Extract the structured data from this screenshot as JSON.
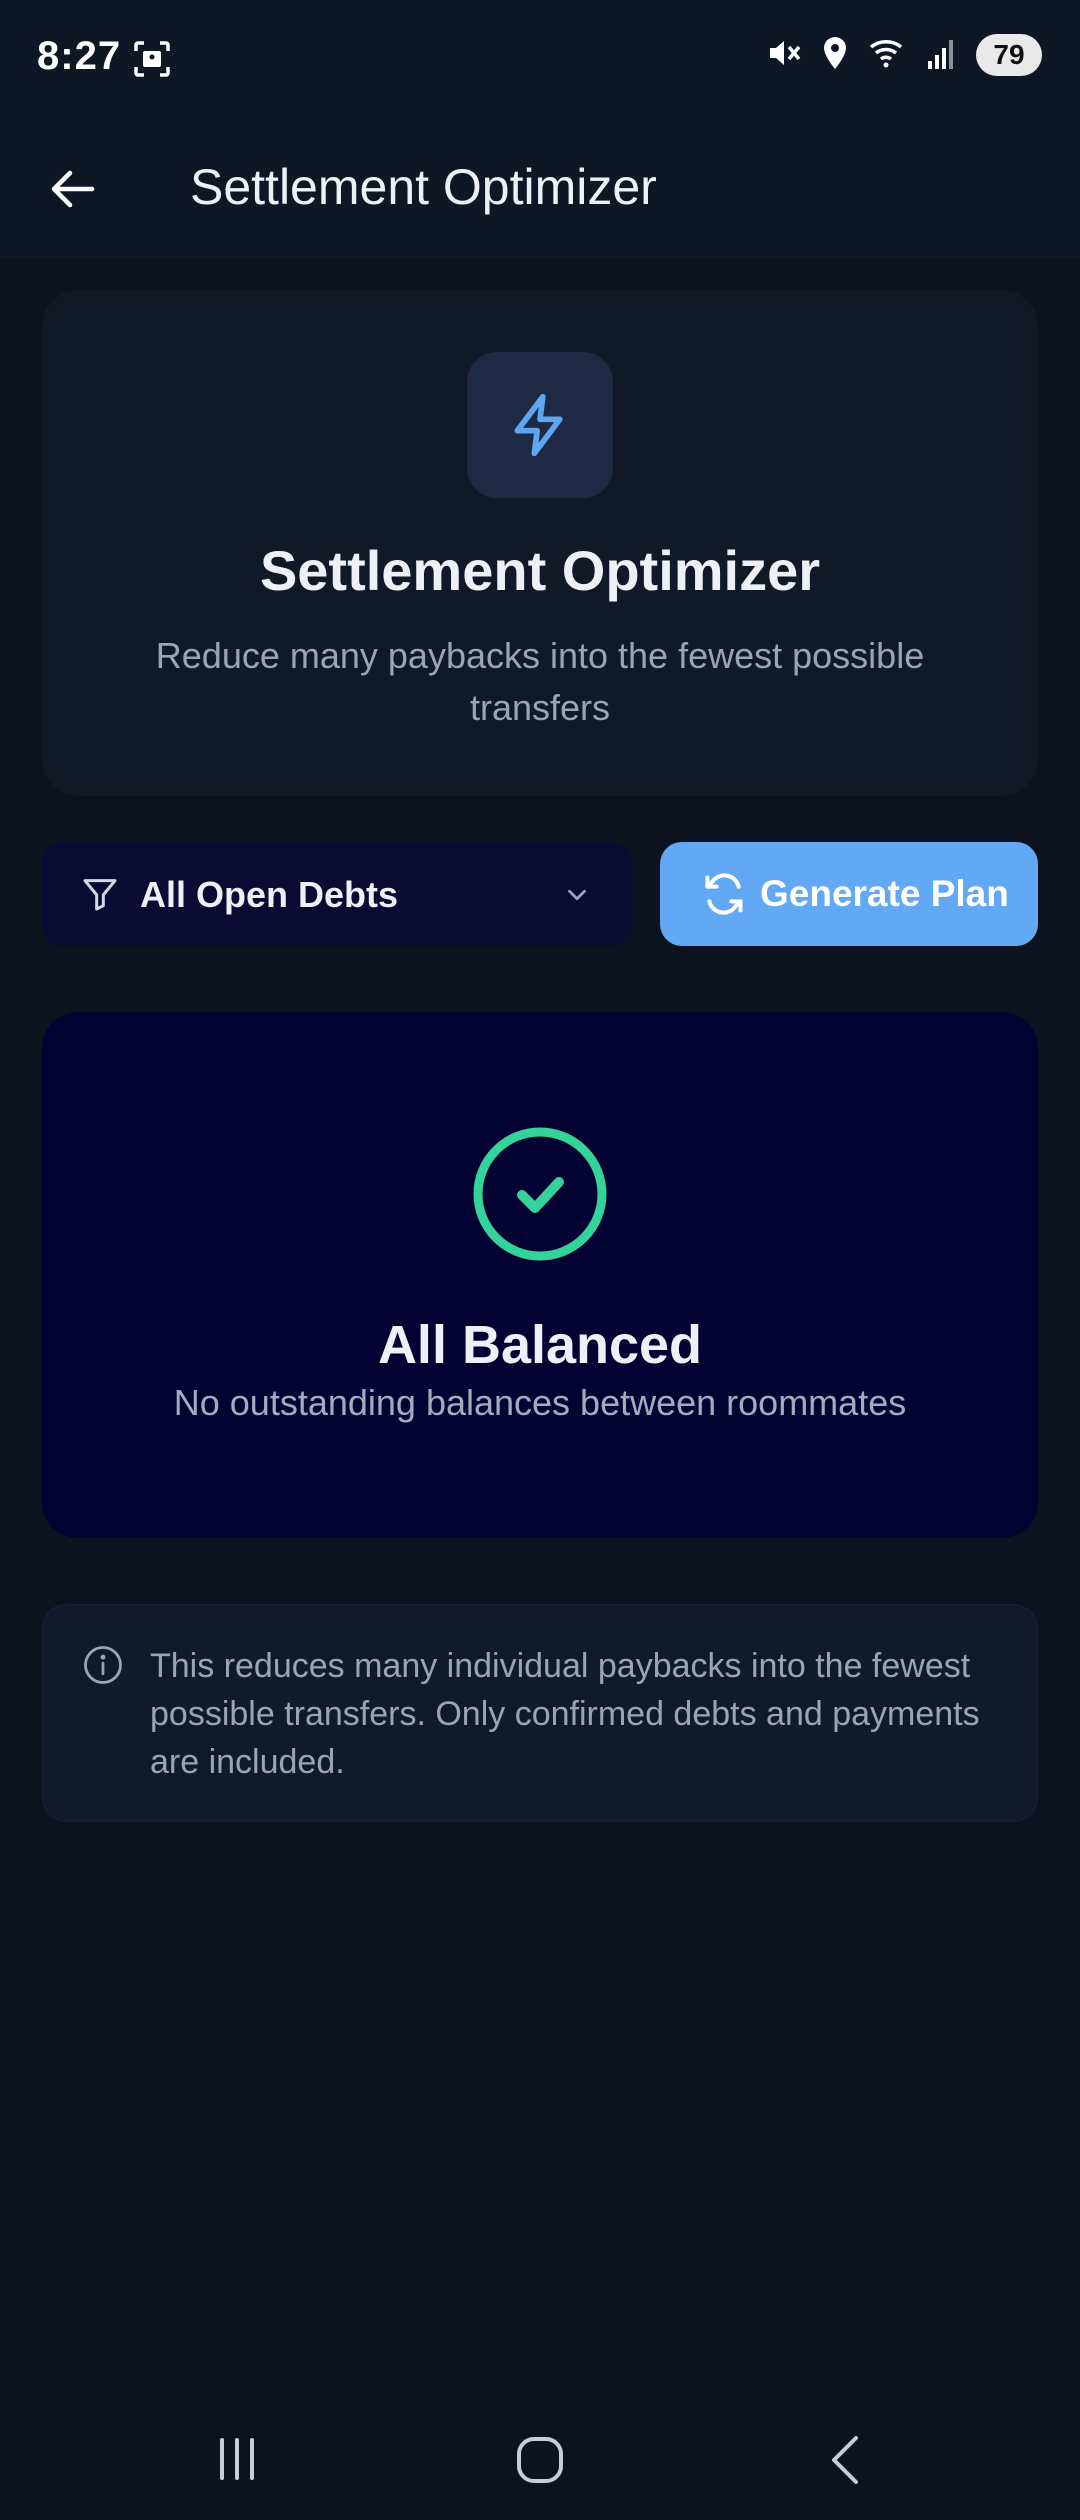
{
  "status_bar": {
    "time": "8:27",
    "battery": "79",
    "icons": [
      "screenshot-icon",
      "mute-icon",
      "location-icon",
      "wifi-icon",
      "signal-icon",
      "battery-icon"
    ]
  },
  "app_bar": {
    "title": "Settlement Optimizer",
    "back_icon": "arrow-left-icon"
  },
  "hero": {
    "icon": "lightning-icon",
    "title": "Settlement Optimizer",
    "subtitle": "Reduce many paybacks into the fewest possible transfers"
  },
  "controls": {
    "filter": {
      "icon": "filter-icon",
      "selected": "All Open Debts"
    },
    "generate_button": {
      "icon": "refresh-icon",
      "label": "Generate Plan"
    }
  },
  "balanced": {
    "icon": "check-circle-icon",
    "title": "All Balanced",
    "subtitle": "No outstanding balances between roommates"
  },
  "info": {
    "icon": "info-icon",
    "text": "This reduces many individual paybacks into the fewest possible transfers. Only confirmed debts and payments are included."
  },
  "nav_bar": {
    "icons": [
      "recents-icon",
      "home-icon",
      "back-icon"
    ]
  },
  "colors": {
    "background": "#0c121e",
    "card": "#111827",
    "accent_blue": "#62a8f5",
    "success_green": "#34d399",
    "dark_navy_card": "#030232"
  }
}
